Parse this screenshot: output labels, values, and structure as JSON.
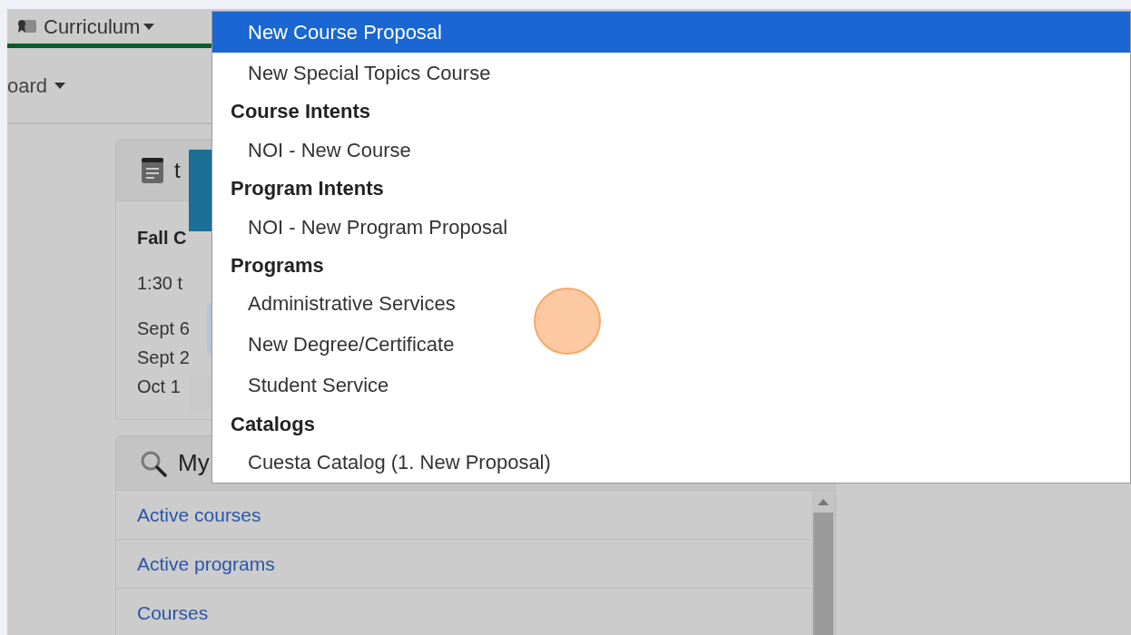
{
  "nav": {
    "menu": "Curriculum",
    "submenu": "oard"
  },
  "schedule_card": {
    "title": "t",
    "heading": "Fall C",
    "time": "1:30 t",
    "dates": [
      "Sept 6",
      "Sept 2",
      "Oct 1"
    ]
  },
  "search_card": {
    "title": "My",
    "links": [
      "Active courses",
      "Active programs",
      "Courses"
    ]
  },
  "dropdown": {
    "items": [
      {
        "kind": "option",
        "label": "New Course Proposal",
        "selected": true
      },
      {
        "kind": "option",
        "label": "New Special Topics Course",
        "selected": false
      },
      {
        "kind": "header",
        "label": "Course Intents"
      },
      {
        "kind": "option",
        "label": "NOI - New Course",
        "selected": false
      },
      {
        "kind": "header",
        "label": "Program Intents"
      },
      {
        "kind": "option",
        "label": "NOI - New Program Proposal",
        "selected": false
      },
      {
        "kind": "header",
        "label": "Programs"
      },
      {
        "kind": "option",
        "label": "Administrative Services",
        "selected": false
      },
      {
        "kind": "option",
        "label": "New Degree/Certificate",
        "selected": false
      },
      {
        "kind": "option",
        "label": "Student Service",
        "selected": false
      },
      {
        "kind": "header",
        "label": "Catalogs"
      },
      {
        "kind": "option",
        "label": "Cuesta Catalog (1. New Proposal)",
        "selected": false
      }
    ]
  }
}
